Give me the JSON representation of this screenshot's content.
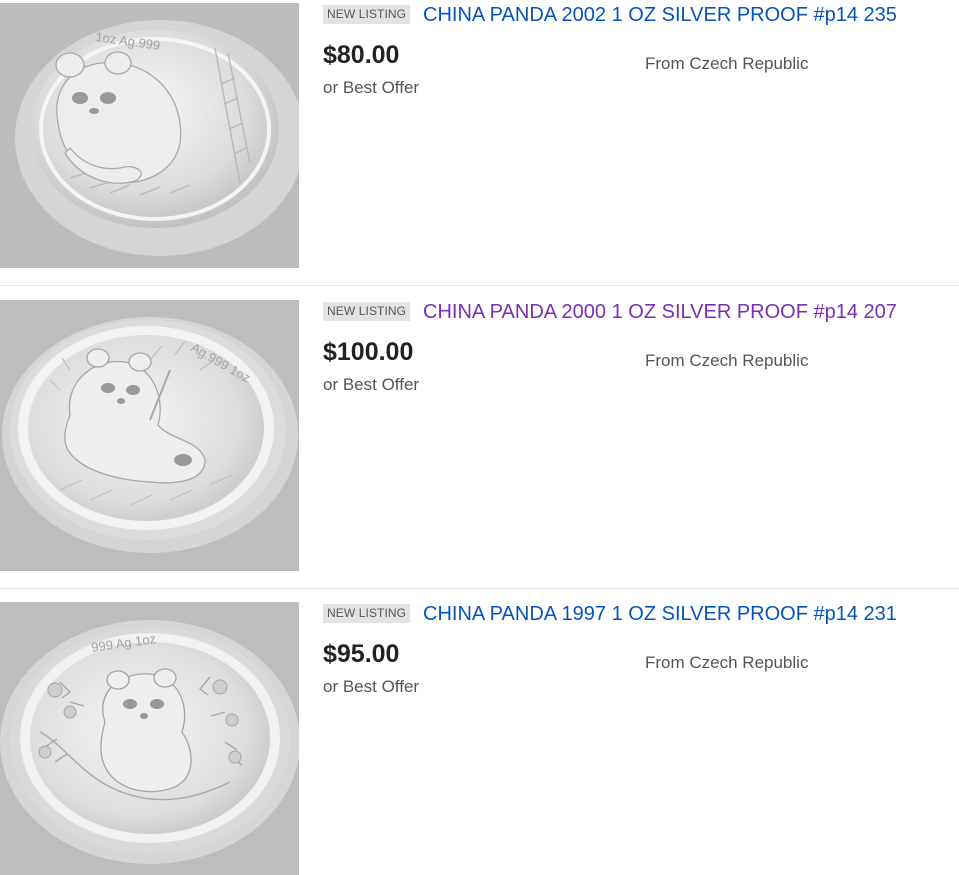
{
  "listings": [
    {
      "badge": "NEW LISTING",
      "title": "CHINA PANDA 2002 1 OZ SILVER PROOF #p14 235",
      "price": "$80.00",
      "offer": "or Best Offer",
      "origin": "From Czech Republic",
      "image_icon": "panda-coin-2002-image",
      "inscription": "1oz Ag.999"
    },
    {
      "badge": "NEW LISTING",
      "title": "CHINA PANDA 2000 1 OZ SILVER PROOF #p14 207",
      "price": "$100.00",
      "offer": "or Best Offer",
      "origin": "From Czech Republic",
      "image_icon": "panda-coin-2000-image",
      "inscription": "Ag.999 1oz"
    },
    {
      "badge": "NEW LISTING",
      "title": "CHINA PANDA 1997 1 OZ SILVER PROOF #p14 231",
      "price": "$95.00",
      "offer": "or Best Offer",
      "origin": "From Czech Republic",
      "image_icon": "panda-coin-1997-image",
      "inscription": "999 Ag 1oz"
    }
  ],
  "colors": {
    "link": "#0654ba",
    "visited_link": "#7b2fb0",
    "price": "#222222",
    "secondary_text": "#555555",
    "badge_bg": "#e3e3e3",
    "thumb_bg": "#bdbdbf"
  }
}
